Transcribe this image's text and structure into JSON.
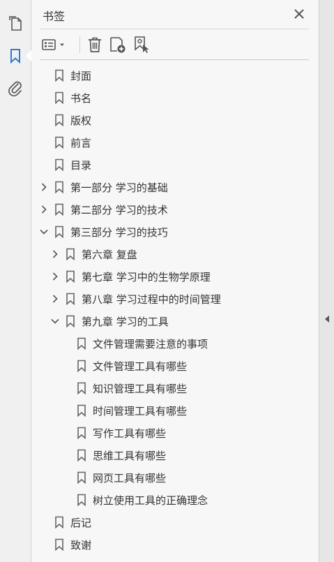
{
  "panel": {
    "title": "书签"
  },
  "left_toolbar": {
    "tools": [
      {
        "name": "page-thumbnails-icon",
        "active": false
      },
      {
        "name": "bookmark-icon",
        "active": true
      },
      {
        "name": "attachment-icon",
        "active": false
      }
    ]
  },
  "bookmarks": [
    {
      "label": "封面",
      "level": 0,
      "state": "leaf"
    },
    {
      "label": "书名",
      "level": 0,
      "state": "leaf"
    },
    {
      "label": "版权",
      "level": 0,
      "state": "leaf"
    },
    {
      "label": "前言",
      "level": 0,
      "state": "leaf"
    },
    {
      "label": "目录",
      "level": 0,
      "state": "leaf"
    },
    {
      "label": "第一部分  学习的基础",
      "level": 0,
      "state": "collapsed"
    },
    {
      "label": "第二部分  学习的技术",
      "level": 0,
      "state": "collapsed"
    },
    {
      "label": "第三部分  学习的技巧",
      "level": 0,
      "state": "expanded"
    },
    {
      "label": "第六章  复盘",
      "level": 1,
      "state": "collapsed"
    },
    {
      "label": "第七章  学习中的生物学原理",
      "level": 1,
      "state": "collapsed"
    },
    {
      "label": "第八章  学习过程中的时间管理",
      "level": 1,
      "state": "collapsed"
    },
    {
      "label": "第九章  学习的工具",
      "level": 1,
      "state": "expanded"
    },
    {
      "label": "文件管理需要注意的事项",
      "level": 2,
      "state": "leaf"
    },
    {
      "label": "文件管理工具有哪些",
      "level": 2,
      "state": "leaf"
    },
    {
      "label": "知识管理工具有哪些",
      "level": 2,
      "state": "leaf"
    },
    {
      "label": "时间管理工具有哪些",
      "level": 2,
      "state": "leaf"
    },
    {
      "label": "写作工具有哪些",
      "level": 2,
      "state": "leaf"
    },
    {
      "label": "思维工具有哪些",
      "level": 2,
      "state": "leaf"
    },
    {
      "label": "网页工具有哪些",
      "level": 2,
      "state": "leaf"
    },
    {
      "label": "树立使用工具的正确理念",
      "level": 2,
      "state": "leaf"
    },
    {
      "label": "后记",
      "level": 0,
      "state": "leaf"
    },
    {
      "label": "致谢",
      "level": 0,
      "state": "leaf"
    }
  ],
  "colors": {
    "active_icon": "#2d7ad6",
    "icon": "#555555",
    "text": "#333333"
  }
}
